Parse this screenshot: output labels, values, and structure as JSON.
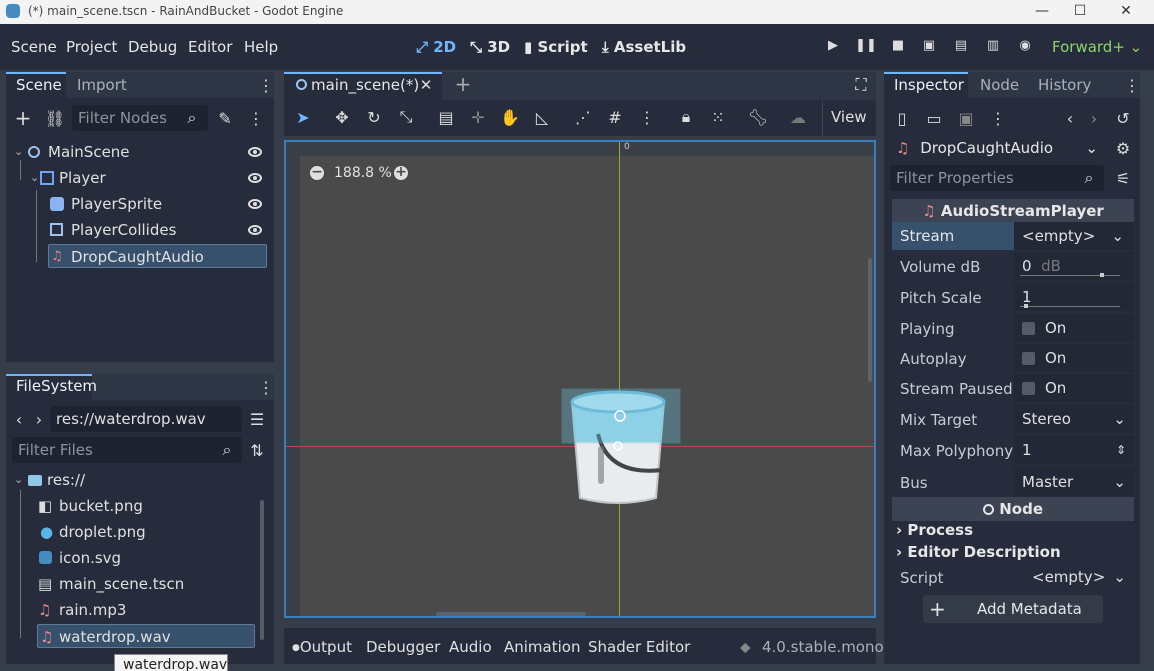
{
  "window": {
    "title": "(*) main_scene.tscn - RainAndBucket - Godot Engine",
    "minimize": "—",
    "maximize": "☐",
    "close": "✕"
  },
  "menubar": {
    "menus": [
      "Scene",
      "Project",
      "Debug",
      "Editor",
      "Help"
    ],
    "workspaces": [
      "2D",
      "3D",
      "Script",
      "AssetLib"
    ],
    "active_workspace": "2D",
    "renderer": "Forward+"
  },
  "scene_dock": {
    "tabs": [
      "Scene",
      "Import"
    ],
    "filter_placeholder": "Filter Nodes",
    "nodes": [
      {
        "name": "MainScene",
        "icon": "node2d-icon"
      },
      {
        "name": "Player",
        "icon": "area2d-icon"
      },
      {
        "name": "PlayerSprite",
        "icon": "sprite-icon"
      },
      {
        "name": "PlayerCollides",
        "icon": "collision-icon"
      },
      {
        "name": "DropCaughtAudio",
        "icon": "audio-icon",
        "selected": true
      }
    ]
  },
  "filesystem_dock": {
    "tab": "FileSystem",
    "path": "res://waterdrop.wav",
    "filter_placeholder": "Filter Files",
    "files": [
      "res://",
      "bucket.png",
      "droplet.png",
      "icon.svg",
      "main_scene.tscn",
      "rain.mp3",
      "waterdrop.wav"
    ],
    "selected": "waterdrop.wav",
    "tooltip": "waterdrop.wav"
  },
  "editor": {
    "scene_tab": "main_scene(*)",
    "zoom": "188.8 %",
    "view_label": "View",
    "ruler_zero": "0"
  },
  "inspector": {
    "tabs": [
      "Inspector",
      "Node",
      "History"
    ],
    "object": "DropCaughtAudio",
    "filter_placeholder": "Filter Properties",
    "class_header": "AudioStreamPlayer",
    "properties": [
      {
        "label": "Stream",
        "value": "<empty>"
      },
      {
        "label": "Volume dB",
        "value": "0",
        "unit": "dB"
      },
      {
        "label": "Pitch Scale",
        "value": "1"
      },
      {
        "label": "Playing",
        "value": "On"
      },
      {
        "label": "Autoplay",
        "value": "On"
      },
      {
        "label": "Stream Paused",
        "value": "On"
      },
      {
        "label": "Mix Target",
        "value": "Stereo"
      },
      {
        "label": "Max Polyphony",
        "value": "1"
      },
      {
        "label": "Bus",
        "value": "Master"
      }
    ],
    "node_header": "Node",
    "groups": [
      "Process",
      "Editor Description"
    ],
    "script_label": "Script",
    "script_value": "<empty>",
    "add_metadata": "Add Metadata"
  },
  "bottom_panel": {
    "tabs": [
      "Output",
      "Debugger",
      "Audio",
      "Animation",
      "Shader Editor"
    ],
    "version": "4.0.stable.mono"
  }
}
